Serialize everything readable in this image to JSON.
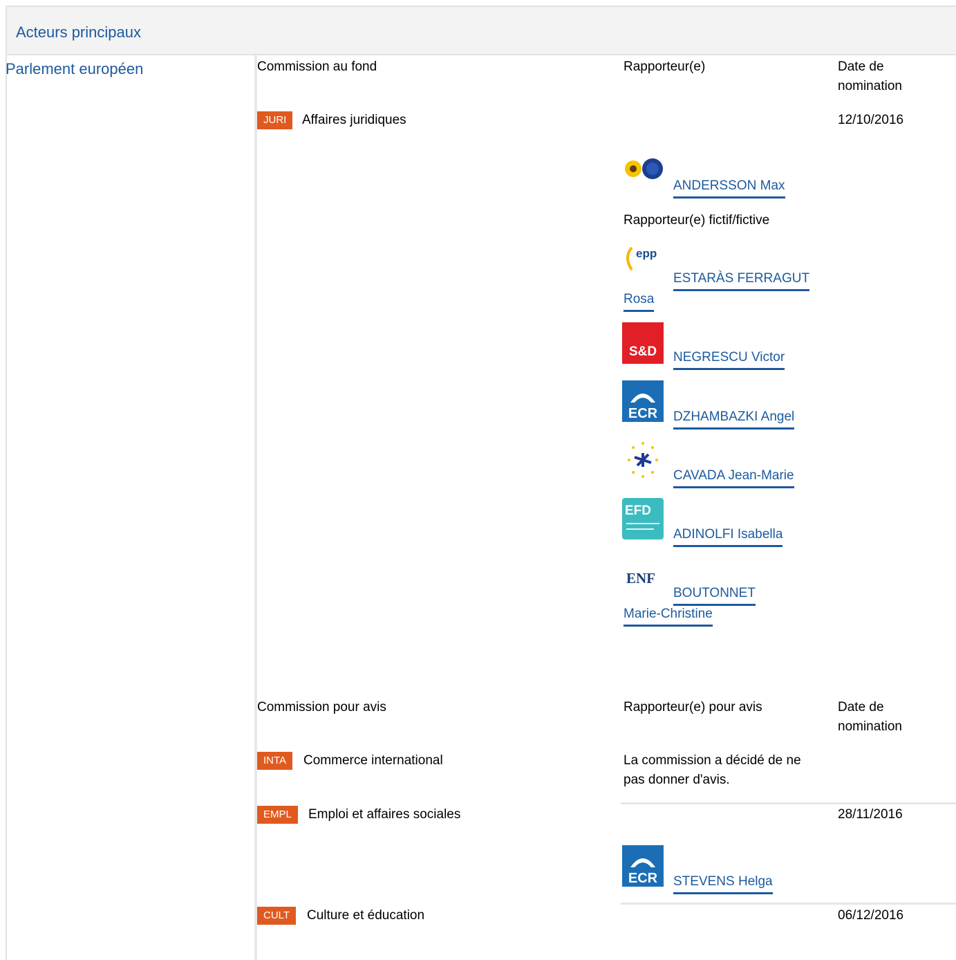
{
  "header": {
    "title": "Acteurs principaux"
  },
  "parliament": {
    "title": "Parlement européen"
  },
  "lead": {
    "col_committee": "Commission au fond",
    "col_rapporteur": "Rapporteur(e)",
    "col_date_1": "Date de",
    "col_date_2": "nomination",
    "committee_code": "JURI",
    "committee_name": "Affaires juridiques",
    "date": "12/10/2016",
    "rapporteur": "ANDERSSON Max",
    "shadow_label": "Rapporteur(e) fictif/fictive",
    "shadows": [
      {
        "name_1": "ESTARÀS FERRAGUT",
        "name_2": "Rosa",
        "group_logo": "epp-logo"
      },
      {
        "name_1": "NEGRESCU Victor",
        "group_logo": "sd-logo"
      },
      {
        "name_1": "DZHAMBAZKI Angel",
        "group_logo": "ecr-logo"
      },
      {
        "name_1": "CAVADA Jean-Marie",
        "group_logo": "alde-logo"
      },
      {
        "name_1": "ADINOLFI Isabella",
        "group_logo": "efdd-logo"
      },
      {
        "name_1": "BOUTONNET",
        "name_2": "Marie-Christine",
        "group_logo": "enf-logo"
      }
    ],
    "rapporteur_group_logo": "greens-efa-logo",
    "logo_texts": {
      "sd": "S&D",
      "ecr": "ECR",
      "epp": "epp",
      "efd": "EFD",
      "enf": "ENF"
    }
  },
  "opinion": {
    "col_committee": "Commission pour avis",
    "col_rapporteur": "Rapporteur(e) pour avis",
    "col_date_1": "Date de",
    "col_date_2": "nomination",
    "rows": [
      {
        "code": "INTA",
        "name": "Commerce international",
        "note_1": "La commission a décidé de ne",
        "note_2": "pas donner d'avis."
      },
      {
        "code": "EMPL",
        "name": "Emploi et affaires sociales",
        "date": "28/11/2016",
        "rapporteur": "STEVENS Helga"
      },
      {
        "code": "CULT",
        "name": "Culture et éducation",
        "date": "06/12/2016"
      }
    ]
  },
  "colors": {
    "link": "#1c5a9e",
    "tag": "#e05a20",
    "header_bg": "#f3f3f3"
  }
}
